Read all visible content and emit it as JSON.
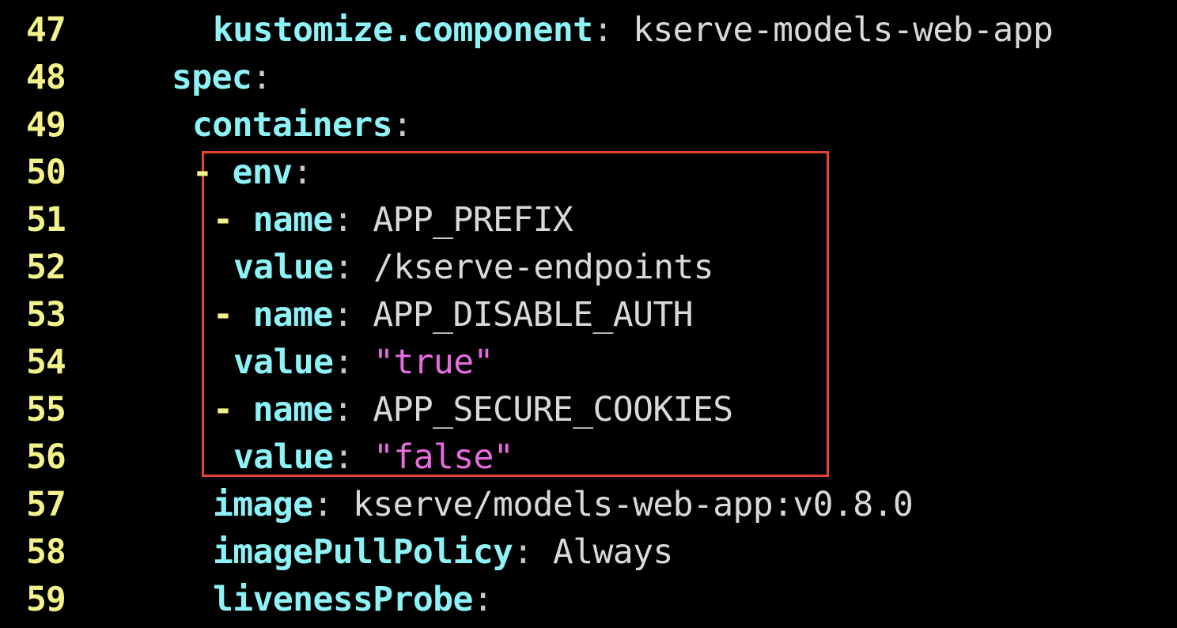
{
  "colors": {
    "background": "#000000",
    "line_number": "#f3f38a",
    "key": "#8ef3f7",
    "scalar": "#d9d9d9",
    "string": "#e76de0",
    "dash": "#f3f38a",
    "highlight_border": "#e0462e"
  },
  "lines": [
    {
      "number": "47",
      "indent": 6,
      "dash": "",
      "key": "kustomize.component",
      "colon": ":",
      "value": " kserve-models-web-app",
      "value_type": "scalar"
    },
    {
      "number": "48",
      "indent": 4,
      "dash": "",
      "key": "spec",
      "colon": ":",
      "value": "",
      "value_type": "scalar"
    },
    {
      "number": "49",
      "indent": 5,
      "dash": "",
      "key": "containers",
      "colon": ":",
      "value": "",
      "value_type": "scalar"
    },
    {
      "number": "50",
      "indent": 5,
      "dash": "- ",
      "key": "env",
      "colon": ":",
      "value": "",
      "value_type": "scalar"
    },
    {
      "number": "51",
      "indent": 6,
      "dash": "- ",
      "key": "name",
      "colon": ":",
      "value": " APP_PREFIX",
      "value_type": "scalar"
    },
    {
      "number": "52",
      "indent": 7,
      "dash": "",
      "key": "value",
      "colon": ":",
      "value": " /kserve-endpoints",
      "value_type": "scalar"
    },
    {
      "number": "53",
      "indent": 6,
      "dash": "- ",
      "key": "name",
      "colon": ":",
      "value": " APP_DISABLE_AUTH",
      "value_type": "scalar"
    },
    {
      "number": "54",
      "indent": 7,
      "dash": "",
      "key": "value",
      "colon": ":",
      "value": " \"true\"",
      "value_type": "string"
    },
    {
      "number": "55",
      "indent": 6,
      "dash": "- ",
      "key": "name",
      "colon": ":",
      "value": " APP_SECURE_COOKIES",
      "value_type": "scalar"
    },
    {
      "number": "56",
      "indent": 7,
      "dash": "",
      "key": "value",
      "colon": ":",
      "value": " \"false\"",
      "value_type": "string"
    },
    {
      "number": "57",
      "indent": 6,
      "dash": "",
      "key": "image",
      "colon": ":",
      "value": " kserve/models-web-app:v0.8.0",
      "value_type": "scalar"
    },
    {
      "number": "58",
      "indent": 6,
      "dash": "",
      "key": "imagePullPolicy",
      "colon": ":",
      "value": " Always",
      "value_type": "scalar"
    },
    {
      "number": "59",
      "indent": 6,
      "dash": "",
      "key": "livenessProbe",
      "colon": ":",
      "value": "",
      "value_type": "scalar"
    }
  ]
}
